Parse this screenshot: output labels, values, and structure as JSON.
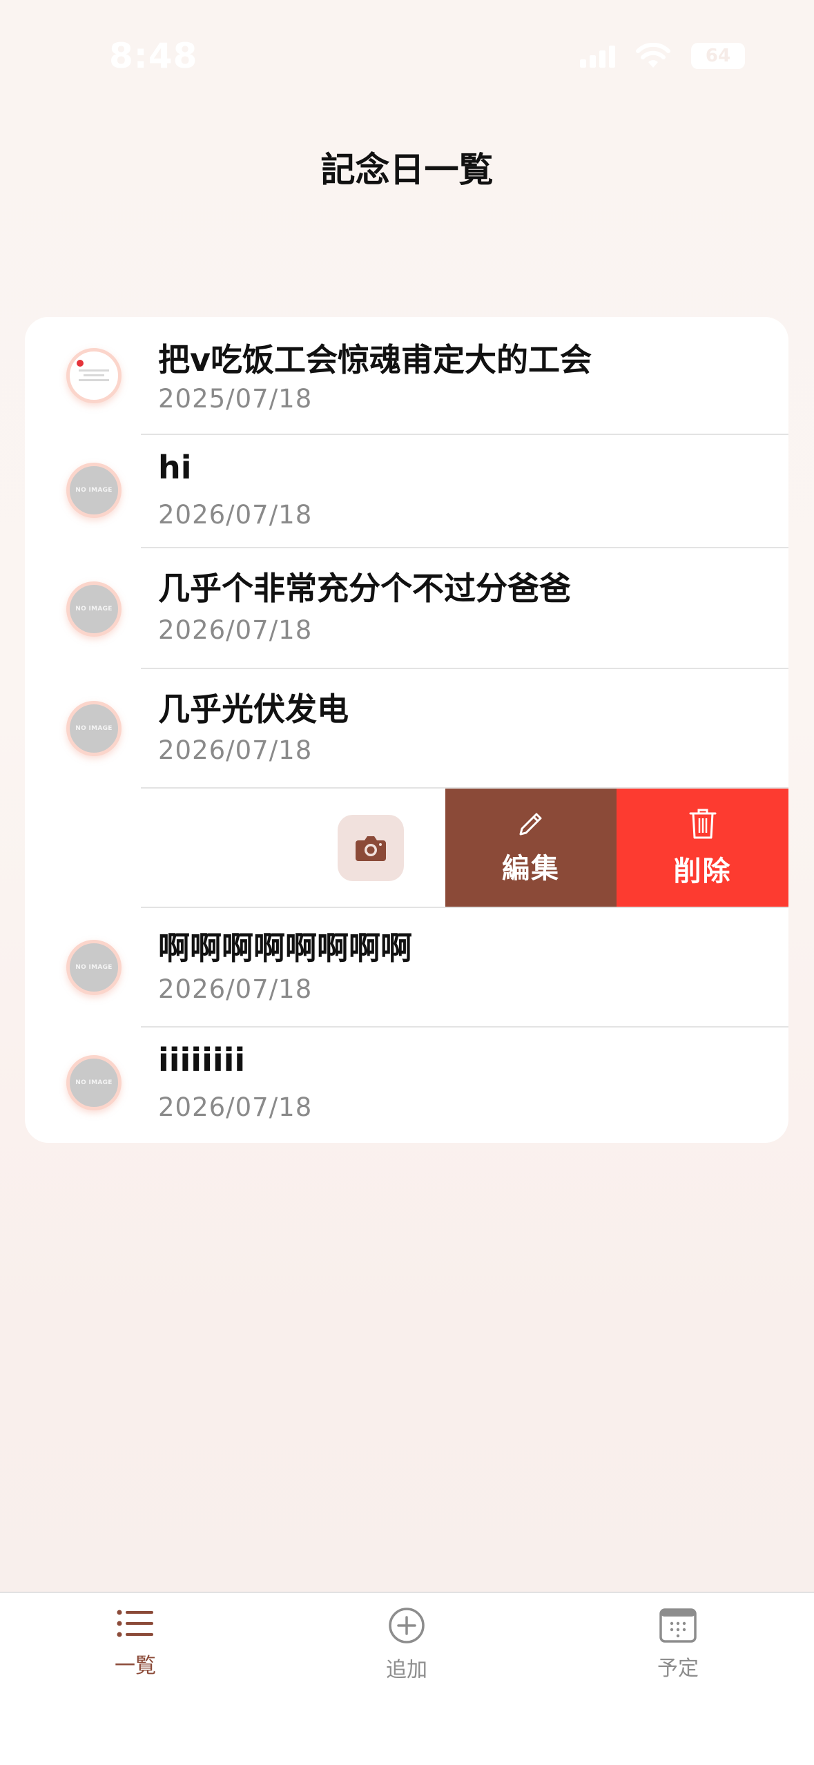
{
  "status_bar": {
    "time": "8:48",
    "battery": "64"
  },
  "header": {
    "title": "記念日一覧"
  },
  "list": {
    "no_image_label": "NO IMAGE",
    "items": [
      {
        "title": "把v吃饭工会惊魂甫定大的工会",
        "date": "2025/07/18",
        "has_photo": true
      },
      {
        "title": "hi",
        "date": "2026/07/18",
        "has_photo": false
      },
      {
        "title": "几乎个非常充分个不过分爸爸",
        "date": "2026/07/18",
        "has_photo": false
      },
      {
        "title": "几乎光伏发电",
        "date": "2026/07/18",
        "has_photo": false
      },
      {
        "title": "啊啊啊啊啊啊啊啊",
        "date": "2026/07/18",
        "has_photo": false
      },
      {
        "title": "iiiiiiii",
        "date": "2026/07/18",
        "has_photo": false
      }
    ],
    "swipe_actions": {
      "edit_label": "編集",
      "delete_label": "削除",
      "edit_color": "#8b4a38",
      "delete_color": "#fd3b30",
      "camera_icon": "camera-icon"
    }
  },
  "tab_bar": {
    "active_color": "#8b4a38",
    "tabs": [
      {
        "label": "一覧",
        "icon": "list-icon",
        "active": true
      },
      {
        "label": "追加",
        "icon": "plus-circle-icon",
        "active": false
      },
      {
        "label": "予定",
        "icon": "calendar-icon",
        "active": false
      }
    ]
  }
}
